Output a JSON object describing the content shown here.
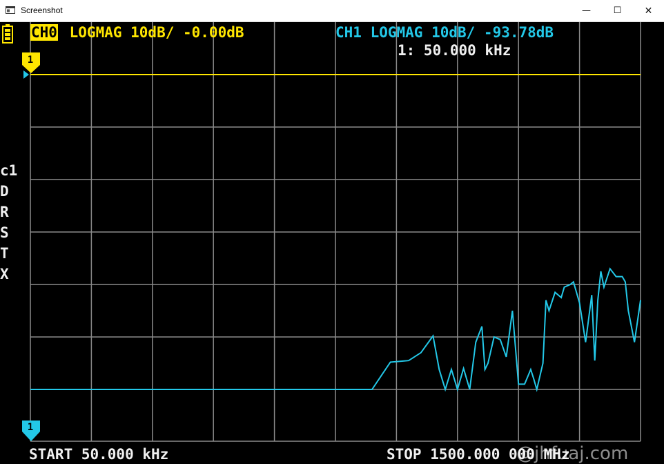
{
  "window": {
    "title": "Screenshot",
    "minimize_glyph": "—",
    "maximize_glyph": "☐",
    "close_glyph": "✕"
  },
  "status": {
    "battery_icon": "battery-icon"
  },
  "channels": {
    "ch0": {
      "tag": "CH0",
      "text": " LOGMAG 10dB/ -0.00dB",
      "color": "#ffe600"
    },
    "ch1": {
      "text": "CH1 LOGMAG 10dB/ -93.78dB",
      "color": "#23c8e8"
    }
  },
  "marker": {
    "readout": "1: 50.000 kHz",
    "label": "1"
  },
  "side_menu": [
    "c1",
    "D",
    "R",
    "S",
    "T",
    "X"
  ],
  "footer": {
    "start": "START 50.000 kHz",
    "stop": "STOP 1500.000 000 MHz"
  },
  "watermark": "@jhfuaj.com",
  "chart_data": {
    "type": "line",
    "x_range_label": [
      "START 50.000 kHz",
      "STOP 1500.000 000 MHz"
    ],
    "grid": true,
    "y_divisions": 7,
    "x_divisions": 10,
    "series": [
      {
        "name": "CH0",
        "color": "#ffe600",
        "y_div_from_top": [
          1,
          1,
          1,
          1,
          1,
          1,
          1,
          1,
          1,
          1,
          1,
          1,
          1,
          1,
          1,
          1,
          1,
          1,
          1,
          1,
          1,
          1,
          1,
          1,
          1,
          1,
          1,
          1,
          1,
          1,
          1,
          1,
          1,
          1,
          1,
          1,
          1,
          1,
          1,
          1,
          1,
          1,
          1,
          1,
          1
        ]
      },
      {
        "name": "CH1",
        "color": "#23c8e8",
        "x_frac": [
          0.0,
          0.53,
          0.55,
          0.56,
          0.59,
          0.62,
          0.64,
          0.66,
          0.67,
          0.68,
          0.69,
          0.7,
          0.71,
          0.72,
          0.73,
          0.74,
          0.745,
          0.75,
          0.76,
          0.77,
          0.78,
          0.79,
          0.8,
          0.81,
          0.82,
          0.825,
          0.83,
          0.84,
          0.845,
          0.85,
          0.86,
          0.87,
          0.875,
          0.885,
          0.89,
          0.9,
          0.91,
          0.92,
          0.925,
          0.93,
          0.935,
          0.94,
          0.95,
          0.96,
          0.97,
          0.975,
          0.98,
          0.99,
          1.0
        ],
        "y_div_from_top": [
          7,
          7,
          7,
          7,
          6.48,
          6.45,
          6.3,
          5.98,
          6.62,
          7,
          6.62,
          7,
          6.6,
          7,
          6.1,
          5.8,
          6.62,
          6.5,
          6.0,
          6.05,
          6.38,
          5.5,
          6.9,
          6.9,
          6.62,
          6.8,
          7,
          6.5,
          5.3,
          5.5,
          5.15,
          5.25,
          5.05,
          5.0,
          4.95,
          5.35,
          6.1,
          5.2,
          6.45,
          5.3,
          4.75,
          5.05,
          4.7,
          4.85,
          4.85,
          4.95,
          5.5,
          6.1,
          5.3
        ]
      }
    ]
  }
}
